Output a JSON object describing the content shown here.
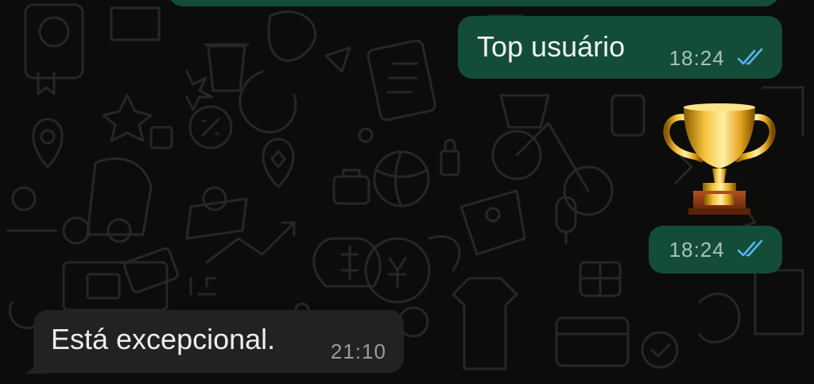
{
  "messages": [
    {
      "direction": "outgoing",
      "text": "Top usuário",
      "time": "18:24",
      "status": "read"
    },
    {
      "direction": "outgoing",
      "type": "sticker",
      "sticker": "trophy-icon",
      "time": "18:24",
      "status": "read"
    },
    {
      "direction": "incoming",
      "text": "Está excepcional.",
      "time": "21:10"
    }
  ],
  "colors": {
    "background": "#0c0c0b",
    "outgoing_bubble": "#134d37",
    "incoming_bubble": "#202321",
    "read_ticks": "#5ab3f0",
    "doodle": "#2a2b2a"
  }
}
